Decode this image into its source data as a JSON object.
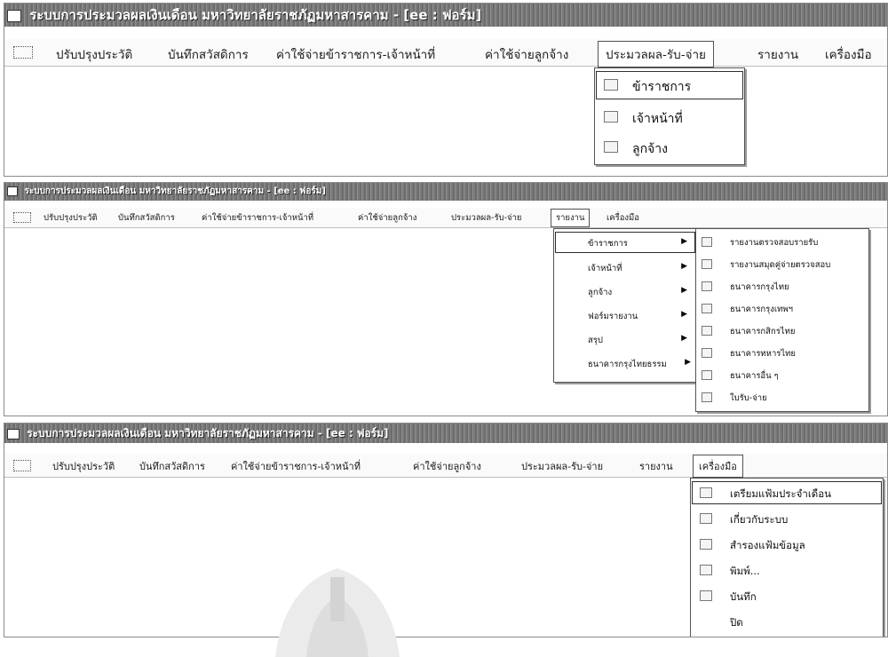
{
  "app_title": "ระบบการประมวลผลเงินเดือน มหาวิทยาลัยราชภัฏมหาสารคาม - [ee : ฟอร์ม]",
  "menu": {
    "update_history": "ปรับปรุงประวัติ",
    "welfare_record": "บันทึกสวัสดิการ",
    "civil_servant_expense": "ค่าใช้จ่ายข้าราชการ-เจ้าหน้าที่",
    "employee_expense": "ค่าใช้จ่ายลูกจ้าง",
    "processing": "ประมวลผล-รับ-จ่าย",
    "reports": "รายงาน",
    "tools": "เครื่องมือ"
  },
  "processing_menu": [
    "ข้าราชการ",
    "เจ้าหน้าที่",
    "ลูกจ้าง"
  ],
  "reports_menu": [
    "ข้าราชการ",
    "เจ้าหน้าที่",
    "ลูกจ้าง",
    "ฟอร์มรายงาน",
    "สรุป",
    "ธนาคารกรุงไทยธรรม"
  ],
  "reports_submenu": [
    "รายงานตรวจสอบรายรับ",
    "รายงานสมุดคู่จ่ายตรวจสอบ",
    "ธนาคารกรุงไทย",
    "ธนาคารกรุงเทพฯ",
    "ธนาคารกสิกรไทย",
    "ธนาคารทหารไทย",
    "ธนาคารอื่น ๆ",
    "ใบรับ-จ่าย"
  ],
  "tools_menu": [
    "เตรียมแฟ้มประจำเดือน",
    "เกี่ยวกับระบบ",
    "สำรองแฟ้มข้อมูล",
    "พิมพ์...",
    "บันทึก",
    "ปิด"
  ],
  "icons": {
    "app": "form-icon",
    "doc": "document-icon",
    "print": "printer-icon",
    "save": "save-icon",
    "backup": "backup-icon",
    "about": "info-icon",
    "arrow": "triangle-right-icon"
  }
}
